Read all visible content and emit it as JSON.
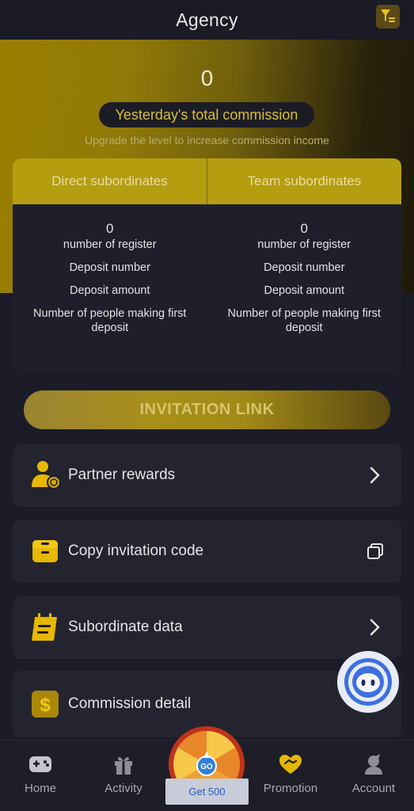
{
  "header": {
    "title": "Agency",
    "filter_icon": "filter-icon"
  },
  "hero": {
    "commission_value": "0",
    "commission_label": "Yesterday's total commission",
    "upgrade_text": "Upgrade the level to increase commission income"
  },
  "subordinates": {
    "direct": {
      "title": "Direct subordinates",
      "register_count": "0",
      "register_label": "number of register",
      "deposit_number_label": "Deposit number",
      "deposit_amount_label": "Deposit amount",
      "first_deposit_label": "Number of people making first deposit"
    },
    "team": {
      "title": "Team subordinates",
      "register_count": "0",
      "register_label": "number of register",
      "deposit_number_label": "Deposit number",
      "deposit_amount_label": "Deposit amount",
      "first_deposit_label": "Number of people making first deposit"
    }
  },
  "invitation": {
    "button_label": "INVITATION LINK"
  },
  "menu": [
    {
      "label": "Partner rewards",
      "icon": "partner-rewards-icon",
      "right": "chevron-right-icon"
    },
    {
      "label": "Copy invitation code",
      "icon": "copy-code-icon",
      "right": "copy-icon"
    },
    {
      "label": "Subordinate data",
      "icon": "subordinate-data-icon",
      "right": "chevron-right-icon"
    },
    {
      "label": "Commission detail",
      "icon": "dollar-icon"
    }
  ],
  "tabbar": {
    "home": "Home",
    "activity": "Activity",
    "wheel_badge": "GO",
    "get_label": "Get 500",
    "promotion": "Promotion",
    "account": "Account"
  },
  "colors": {
    "accent_gold": "#d4b000",
    "background": "#1b1c28",
    "card": "#23242f"
  }
}
